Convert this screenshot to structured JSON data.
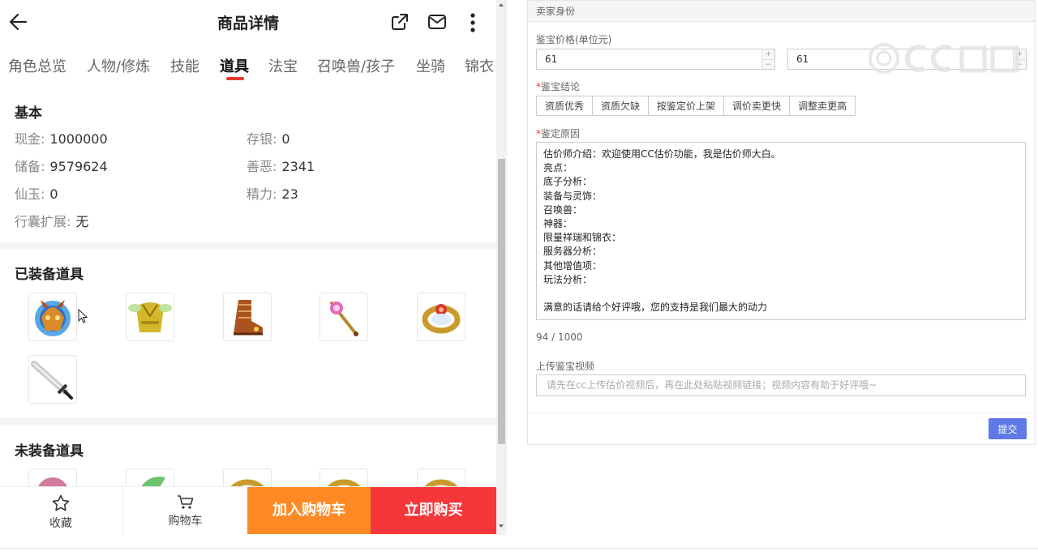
{
  "header": {
    "title": "商品详情"
  },
  "tabs": [
    "角色总览",
    "人物/修炼",
    "技能",
    "道具",
    "法宝",
    "召唤兽/孩子",
    "坐骑",
    "锦衣"
  ],
  "basic": {
    "title": "基本",
    "cash_label": "现金:",
    "cash_value": "1000000",
    "deposit_label": "存银:",
    "deposit_value": "0",
    "reserve_label": "储备:",
    "reserve_value": "9579624",
    "karma_label": "善恶:",
    "karma_value": "2341",
    "jade_label": "仙玉:",
    "jade_value": "0",
    "energy_label": "精力:",
    "energy_value": "23",
    "bag_label": "行囊扩展:",
    "bag_value": "无"
  },
  "equipped": {
    "title": "已装备道具"
  },
  "unequipped": {
    "title": "未装备道具"
  },
  "bottom": {
    "favorite_label": "收藏",
    "cart_label": "购物车",
    "add_to_cart": "加入购物车",
    "buy_now": "立即购买"
  },
  "form": {
    "panel_title": "卖家身份",
    "price_label": "鉴宝价格(单位元)",
    "price_min": "61",
    "price_max": "61",
    "conclusion_label": "鉴宝结论",
    "conclusions": [
      "资质优秀",
      "资质欠缺",
      "按鉴定价上架",
      "调价卖更快",
      "调整卖更高"
    ],
    "reason_label": "鉴定原因",
    "reason_text": "估价师介绍：欢迎使用CC估价功能，我是估价师大白。\n亮点：\n底子分析：\n装备与灵饰：\n召唤兽：\n神器：\n限量祥瑞和锦衣：\n服务器分析：\n其他增值项：\n玩法分析：\n\n满意的话请给个好评哦，您的支持是我们最大的动力",
    "counter": "94 / 1000",
    "video_label": "上传鉴宝视频",
    "video_placeholder": "请先在cc上传估价视频后，再在此处粘贴视频链接；视频内容有助于好评哦~",
    "submit": "提交"
  },
  "colors": {
    "accent_red": "#e8392f",
    "add_cart_orange": "#ff8a25",
    "buy_now_red": "#f6373a",
    "submit_blue": "#5f79e6"
  }
}
